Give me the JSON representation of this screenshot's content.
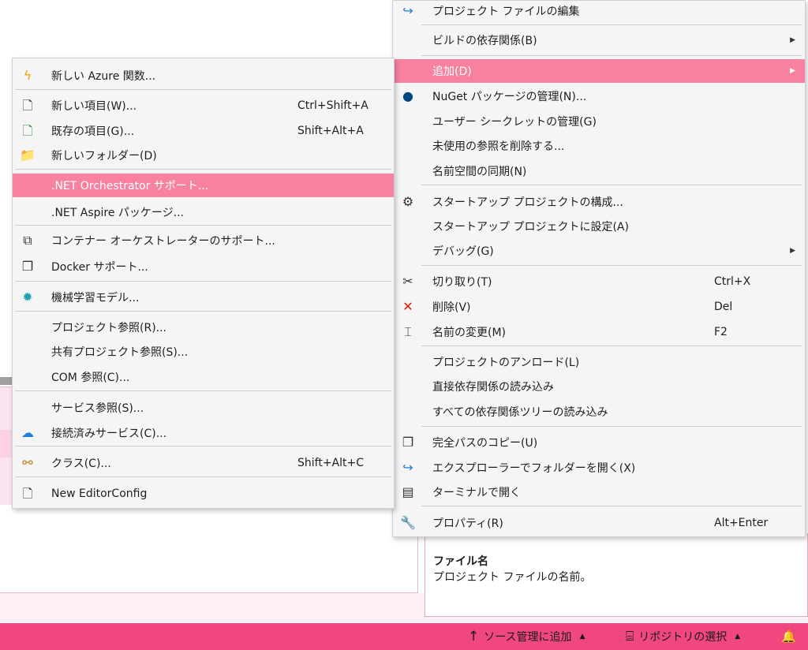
{
  "right_menu": {
    "items": [
      {
        "label": "プロジェクト ファイルの編集",
        "icon": "redo-arrow-icon",
        "glyph": "↪",
        "color": "#1e7fd9"
      },
      {
        "label": "ビルドの依存関係(B)",
        "submenu": true
      },
      {
        "label": "追加(D)",
        "submenu": true,
        "highlighted": true
      },
      {
        "label": "NuGet パッケージの管理(N)...",
        "icon": "nuget-icon",
        "glyph": "●",
        "color": "#004880"
      },
      {
        "label": "ユーザー シークレットの管理(G)"
      },
      {
        "label": "未使用の参照を削除する..."
      },
      {
        "label": "名前空間の同期(N)"
      },
      {
        "label": "スタートアップ プロジェクトの構成...",
        "icon": "gear-icon",
        "glyph": "⚙",
        "color": "#333333"
      },
      {
        "label": "スタートアップ プロジェクトに設定(A)"
      },
      {
        "label": "デバッグ(G)",
        "submenu": true
      },
      {
        "label": "切り取り(T)",
        "shortcut": "Ctrl+X",
        "icon": "scissors-icon",
        "glyph": "✂",
        "color": "#333333"
      },
      {
        "label": "削除(V)",
        "shortcut": "Del",
        "icon": "delete-x-icon",
        "glyph": "✕",
        "color": "#e51400"
      },
      {
        "label": "名前の変更(M)",
        "shortcut": "F2",
        "icon": "rename-icon",
        "glyph": "⌶",
        "color": "#333333"
      },
      {
        "label": "プロジェクトのアンロード(L)"
      },
      {
        "label": "直接依存関係の読み込み"
      },
      {
        "label": "すべての依存関係ツリーの読み込み"
      },
      {
        "label": "完全パスのコピー(U)",
        "icon": "copy-icon",
        "glyph": "❐",
        "color": "#333333"
      },
      {
        "label": "エクスプローラーでフォルダーを開く(X)",
        "icon": "redo-arrow-icon",
        "glyph": "↪",
        "color": "#1e7fd9"
      },
      {
        "label": "ターミナルで開く",
        "icon": "terminal-icon",
        "glyph": "▤",
        "color": "#333333"
      },
      {
        "label": "プロパティ(R)",
        "shortcut": "Alt+Enter",
        "icon": "wrench-icon",
        "glyph": "🔧",
        "color": "#333333"
      }
    ]
  },
  "left_menu": {
    "items": [
      {
        "label": "新しい Azure 関数...",
        "icon": "azure-function-icon",
        "glyph": "ϟ",
        "color": "#f0a30a"
      },
      {
        "label": "新しい項目(W)...",
        "shortcut": "Ctrl+Shift+A",
        "icon": "new-item-icon",
        "glyph": "🗋",
        "color": "#333333"
      },
      {
        "label": "既存の項目(G)...",
        "shortcut": "Shift+Alt+A",
        "icon": "existing-item-icon",
        "glyph": "🗋",
        "color": "#388a34"
      },
      {
        "label": "新しいフォルダー(D)",
        "icon": "new-folder-icon",
        "glyph": "📁",
        "color": "#dcb67a"
      },
      {
        "label": ".NET Orchestrator サポート...",
        "highlighted": true
      },
      {
        "label": ".NET Aspire パッケージ..."
      },
      {
        "label": "コンテナー オーケストレーターのサポート...",
        "icon": "container-orchestrator-icon",
        "glyph": "⧉",
        "color": "#333333"
      },
      {
        "label": "Docker サポート...",
        "icon": "docker-icon",
        "glyph": "❒",
        "color": "#333333"
      },
      {
        "label": "機械学習モデル...",
        "icon": "ml-model-icon",
        "glyph": "✹",
        "color": "#1ba1b0"
      },
      {
        "label": "プロジェクト参照(R)..."
      },
      {
        "label": "共有プロジェクト参照(S)..."
      },
      {
        "label": "COM 参照(C)..."
      },
      {
        "label": "サービス参照(S)..."
      },
      {
        "label": "接続済みサービス(C)...",
        "icon": "connected-service-icon",
        "glyph": "☁",
        "color": "#1e7fd9"
      },
      {
        "label": "クラス(C)...",
        "shortcut": "Shift+Alt+C",
        "icon": "class-icon",
        "glyph": "⚯",
        "color": "#c27d0e"
      },
      {
        "label": "New EditorConfig",
        "icon": "file-icon",
        "glyph": "🗋",
        "color": "#333333"
      }
    ]
  },
  "properties": {
    "title": "ファイル名",
    "description": "プロジェクト ファイルの名前。"
  },
  "statusbar": {
    "source_control": "ソース管理に追加",
    "repository": "リポジトリの選択",
    "caret": "▲",
    "up_arrow_glyph": "↑",
    "repo_glyph": "⌸",
    "bell_glyph": "🔔"
  },
  "submenu_glyph": "▶",
  "colors": {
    "highlight": "#f7819f",
    "statusbar": "#f0487e"
  }
}
